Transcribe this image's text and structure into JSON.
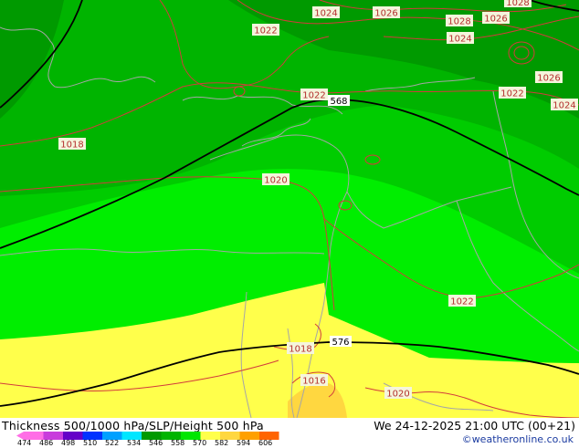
{
  "map": {
    "pressure_labels": [
      {
        "text": "1024"
      },
      {
        "text": "1026"
      },
      {
        "text": "1028"
      },
      {
        "text": "1026"
      },
      {
        "text": "1028"
      },
      {
        "text": "1022"
      },
      {
        "text": "1024"
      },
      {
        "text": "1026"
      },
      {
        "text": "1022"
      },
      {
        "text": "1024"
      },
      {
        "text": "1022"
      },
      {
        "text": "1018"
      },
      {
        "text": "1020"
      },
      {
        "text": "1022"
      },
      {
        "text": "1018"
      },
      {
        "text": "1016"
      },
      {
        "text": "1020"
      }
    ],
    "height_labels": [
      {
        "text": "568"
      },
      {
        "text": "576"
      }
    ],
    "colors": {
      "band_534_540": "#009a00",
      "band_540_546": "#00b400",
      "band_546_552": "#00cc00",
      "band_552_558": "#00ee00",
      "band_558_570": "#ffff4b",
      "band_570_576": "#ffd740",
      "pressure_isobar": "#d23c3c",
      "height_contour": "#000000",
      "coastline": "#a6a6a6",
      "label_box": "#f5f5dc",
      "label_text": "#b42e2e"
    }
  },
  "footer": {
    "title": "Thickness 500/1000 hPa/SLP/Height 500 hPa",
    "datetime": "We 24-12-2025 21:00 UTC (00+21)",
    "credit": "©weatheronline.co.uk",
    "scale_ticks": [
      "474",
      "486",
      "498",
      "510",
      "522",
      "534",
      "546",
      "558",
      "570",
      "582",
      "594",
      "606"
    ],
    "scale_colors": [
      "#ff6ee6",
      "#c83cdc",
      "#6400c8",
      "#0032ff",
      "#00a0ff",
      "#00e6ff",
      "#009a00",
      "#00b400",
      "#00e600",
      "#ffff4b",
      "#ffd740",
      "#ffa000",
      "#ff6400"
    ]
  }
}
